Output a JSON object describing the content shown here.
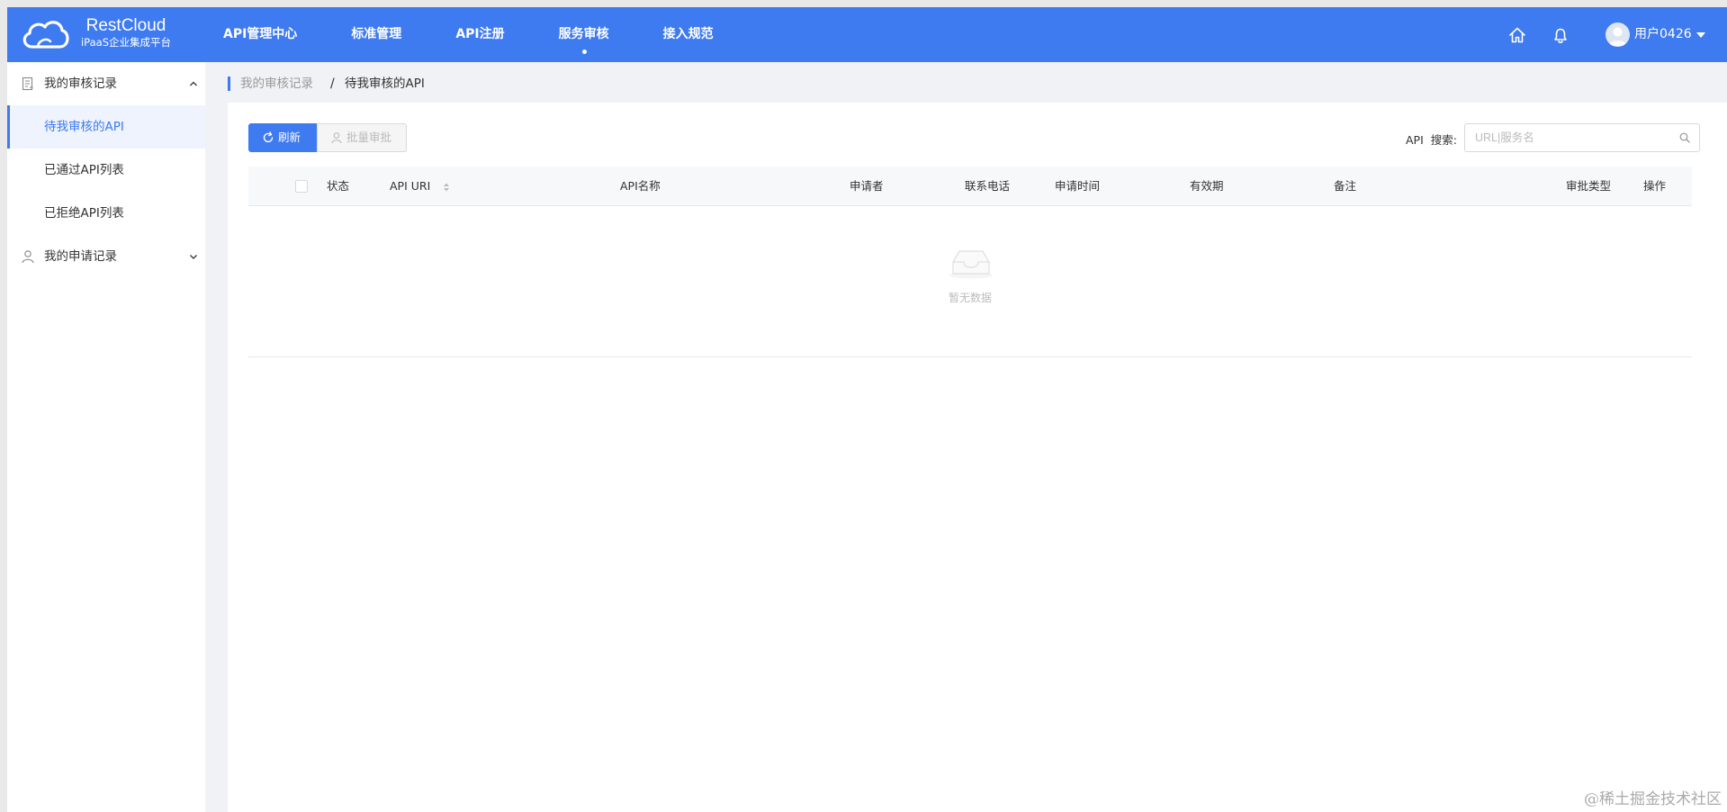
{
  "brand": {
    "name": "RestCloud",
    "subtitle": "iPaaS企业集成平台"
  },
  "nav": [
    {
      "label": "API管理中心",
      "active": false
    },
    {
      "label": "标准管理",
      "active": false
    },
    {
      "label": "API注册",
      "active": false
    },
    {
      "label": "服务审核",
      "active": true
    },
    {
      "label": "接入规范",
      "active": false
    }
  ],
  "header": {
    "user_name": "用户0426",
    "icons": [
      "home-icon",
      "bell-icon",
      "avatar-icon",
      "caret-down-icon"
    ]
  },
  "sidebar": {
    "groups": [
      {
        "label": "我的审核记录",
        "icon": "document-icon",
        "expanded": true,
        "items": [
          {
            "label": "待我审核的API",
            "active": true
          },
          {
            "label": "已通过API列表",
            "active": false
          },
          {
            "label": "已拒绝API列表",
            "active": false
          }
        ]
      },
      {
        "label": "我的申请记录",
        "icon": "user-icon",
        "expanded": false,
        "items": []
      }
    ]
  },
  "breadcrumb": {
    "parent": "我的审核记录",
    "separator": "/",
    "current": "待我审核的API"
  },
  "toolbar": {
    "refresh_label": "刷新",
    "batch_label": "批量审批",
    "search_label": "API  搜索:",
    "search_placeholder": "URL|服务名",
    "search_value": ""
  },
  "table": {
    "columns": [
      "状态",
      "API URI",
      "API名称",
      "申请者",
      "联系电话",
      "申请时间",
      "有效期",
      "备注",
      "审批类型",
      "操作"
    ],
    "rows": [],
    "empty_text": "暂无数据"
  },
  "watermark": "@稀土掘金技术社区",
  "colors": {
    "primary": "#3e7af0",
    "page_bg": "#f0f2f5",
    "active_bg": "#eef3fd"
  }
}
